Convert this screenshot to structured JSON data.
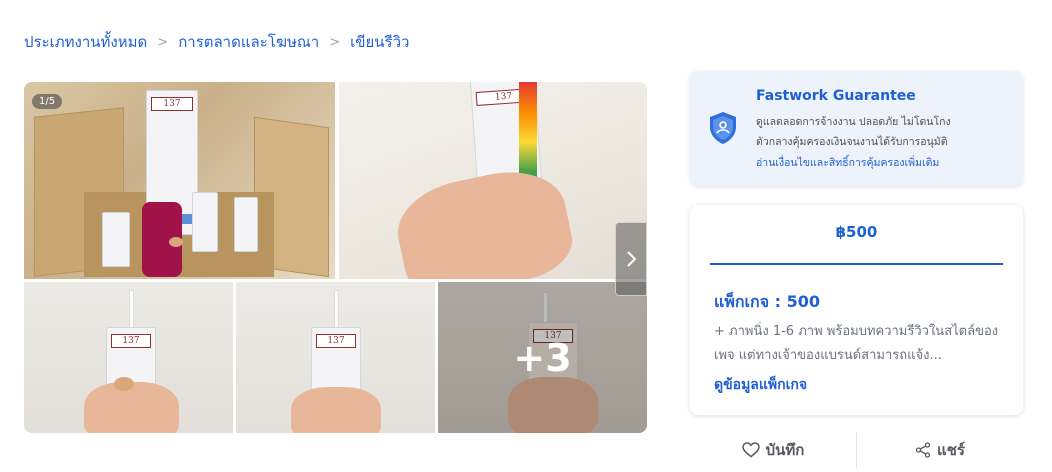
{
  "breadcrumb": {
    "items": [
      "ประเภทงานทั้งหมด",
      "การตลาดและโฆษณา",
      "เขียนรีวิว"
    ],
    "separator": ">"
  },
  "gallery": {
    "counter": "1/5",
    "more_label": "+3",
    "carton_text": "137"
  },
  "guarantee": {
    "title": "Fastwork Guarantee",
    "desc_line1": "ดูแลตลอดการจ้างงาน ปลอดภัย ไม่โดนโกง",
    "desc_line2": "ตัวกลางคุ้มครองเงินจนงานได้รับการอนุมัติ",
    "link": "อ่านเงื่อนไขและสิทธิ์การคุ้มครองเพิ่มเติม"
  },
  "package": {
    "price": "฿500",
    "name": "แพ็กเกจ : 500",
    "description": "+ ภาพนิ่ง 1-6 ภาพ พร้อมบทความรีวิวในสไตล์ของเพจ แต่ทางเจ้าของแบรนด์สามารถแจ้ง...",
    "link": "ดูข้อมูลแพ็กเกจ"
  },
  "actions": {
    "save_label": "บันทึก",
    "share_label": "แชร์"
  },
  "colors": {
    "accent": "#1f5fd6",
    "guarantee_bg": "#eef3fb"
  },
  "icons": {
    "next": "chevron-right-icon",
    "shield": "shield-icon",
    "heart": "heart-icon",
    "share": "share-icon"
  }
}
